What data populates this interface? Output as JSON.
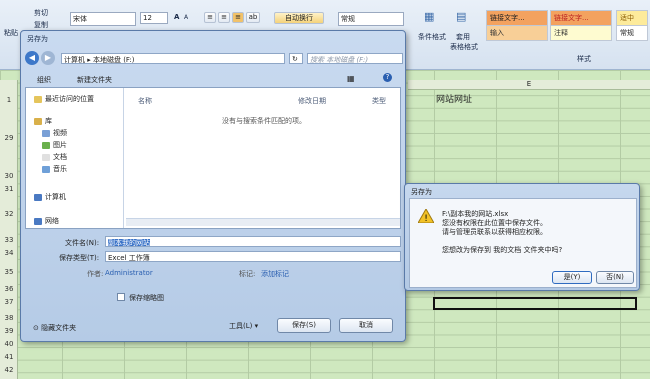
{
  "ribbon": {
    "clipboard": {
      "cut": "剪切",
      "copy": "复制",
      "paste": "粘贴"
    },
    "font_name": "宋体",
    "font_size": "12",
    "font_grow": "A",
    "font_shrink": "A",
    "wrap_text": "自动换行",
    "number_format": "常规",
    "conditional_format": "条件格式",
    "format_table": "套用",
    "format_table2": "表格格式",
    "styles_label": "样式",
    "styles": [
      {
        "label": "链接文字...",
        "bg": "#f3a25f",
        "color": "#222"
      },
      {
        "label": "链接文字...",
        "bg": "#f3a25f",
        "color": "#b22"
      },
      {
        "label": "适中",
        "bg": "#fdeb9b",
        "color": "#8a5a00"
      },
      {
        "label": "输入",
        "bg": "#f8cf97",
        "color": "#333"
      },
      {
        "label": "注释",
        "bg": "#fefbd0",
        "color": "#333"
      },
      {
        "label": "常规",
        "bg": "#ffffff",
        "color": "#222"
      }
    ]
  },
  "sheet": {
    "column_header": "E",
    "cell_e1": "网站网址",
    "row_numbers": [
      "1",
      "29",
      "30",
      "31",
      "32",
      "33",
      "34",
      "35",
      "36",
      "37",
      "38",
      "39",
      "40",
      "41",
      "42"
    ]
  },
  "save_dialog": {
    "title": "另存为",
    "breadcrumb": [
      "计算机",
      "本地磁盘 (F:)"
    ],
    "search_placeholder": "搜索 本地磁盘 (F:)",
    "organize": "组织",
    "new_folder": "新建文件夹",
    "nav": [
      "最近访问的位置",
      "库",
      "视频",
      "图片",
      "文档",
      "音乐",
      "计算机",
      "网络"
    ],
    "col_name": "名称",
    "col_date": "修改日期",
    "col_type": "类型",
    "empty_msg": "没有与搜索条件匹配的项。",
    "filename_label": "文件名(N):",
    "filename_value": "副本我的网站",
    "filetype_label": "保存类型(T):",
    "filetype_value": "Excel 工作簿",
    "author_label": "作者:",
    "author_value": "Administrator",
    "tags_label": "标记:",
    "tags_value": "添加标记",
    "thumbnail_label": "保存缩略图",
    "hide_folders": "隐藏文件夹",
    "tools": "工具(L)",
    "save": "保存(S)",
    "cancel": "取消"
  },
  "alert": {
    "title": "另存为",
    "lines": [
      "F:\\副本我的网站.xlsx",
      "您没有权限在此位置中保存文件。",
      "请与管理员联系以获得相应权限。",
      "",
      "您想改为保存到 我的文档 文件夹中吗?"
    ],
    "yes": "是(Y)",
    "no": "否(N)"
  }
}
